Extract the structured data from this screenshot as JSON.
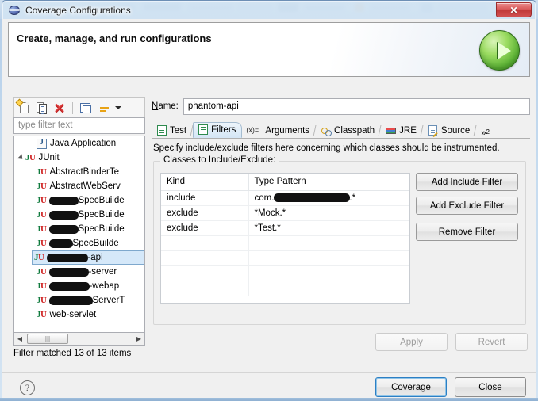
{
  "window": {
    "title": "Coverage Configurations",
    "title_icon": "eclipse-globe-icon",
    "close_label": "✕"
  },
  "banner": {
    "title": "Create, manage, and run configurations",
    "run_icon": "run-coverage-icon"
  },
  "toolbar": {
    "icons": [
      {
        "name": "new-configuration-icon",
        "title": "New launch configuration"
      },
      {
        "name": "duplicate-configuration-icon",
        "title": "Duplicate"
      },
      {
        "name": "delete-configuration-icon",
        "title": "Delete"
      },
      {
        "name": "collapse-all-icon",
        "title": "Collapse All"
      },
      {
        "name": "filter-launch-icon",
        "title": "Filter"
      },
      {
        "name": "chevron-down-icon",
        "title": "Menu"
      }
    ]
  },
  "filter": {
    "placeholder": "type filter text",
    "value": "",
    "status": "Filter matched 13 of 13 items"
  },
  "tree": {
    "items": [
      {
        "label": "Java Application",
        "icon": "java-application-icon",
        "indent": 1,
        "twisty": false,
        "selected": false,
        "redact": 0
      },
      {
        "label": "JUnit",
        "icon": "junit-icon",
        "indent": 0,
        "twisty": true,
        "selected": false,
        "redact": 0
      },
      {
        "label": "AbstractBinderTe",
        "icon": "junit-icon",
        "indent": 2,
        "twisty": false,
        "selected": false,
        "redact": 0
      },
      {
        "label": "AbstractWebServ",
        "icon": "junit-icon",
        "indent": 2,
        "twisty": false,
        "selected": false,
        "redact": 0
      },
      {
        "label": "SpecBuilde",
        "icon": "junit-icon",
        "indent": 2,
        "twisty": false,
        "selected": false,
        "redact": 37
      },
      {
        "label": "SpecBuilde",
        "icon": "junit-icon",
        "indent": 2,
        "twisty": false,
        "selected": false,
        "redact": 37
      },
      {
        "label": "SpecBuilde",
        "icon": "junit-icon",
        "indent": 2,
        "twisty": false,
        "selected": false,
        "redact": 37
      },
      {
        "label": "SpecBuilde",
        "icon": "junit-icon",
        "indent": 2,
        "twisty": false,
        "selected": false,
        "redact": 30
      },
      {
        "label": "-api",
        "icon": "junit-icon",
        "indent": 2,
        "twisty": false,
        "selected": true,
        "redact": 52
      },
      {
        "label": "-server",
        "icon": "junit-icon",
        "indent": 2,
        "twisty": false,
        "selected": false,
        "redact": 50
      },
      {
        "label": "-webap",
        "icon": "junit-icon",
        "indent": 2,
        "twisty": false,
        "selected": false,
        "redact": 51
      },
      {
        "label": "ServerT",
        "icon": "junit-icon",
        "indent": 2,
        "twisty": false,
        "selected": false,
        "redact": 55
      },
      {
        "label": "web-servlet",
        "icon": "junit-icon",
        "indent": 2,
        "twisty": false,
        "selected": false,
        "redact": 0
      }
    ]
  },
  "config": {
    "name_label": "Name:",
    "name_mnemonic": "N",
    "name_value": "phantom-api",
    "tabs": [
      {
        "label": "Test",
        "icon": "test-tab-icon",
        "active": false
      },
      {
        "label": "Filters",
        "icon": "filters-tab-icon",
        "active": true
      },
      {
        "label": "Arguments",
        "icon": "arguments-tab-icon",
        "active": false
      },
      {
        "label": "Classpath",
        "icon": "classpath-tab-icon",
        "active": false
      },
      {
        "label": "JRE",
        "icon": "jre-tab-icon",
        "active": false
      },
      {
        "label": "Source",
        "icon": "source-tab-icon",
        "active": false
      }
    ],
    "tabs_overflow": "»",
    "tabs_overflow_count": "2",
    "description": "Specify include/exclude filters here concerning which classes should be instrumented.",
    "group_title": "Classes to Include/Exclude:",
    "table": {
      "columns": [
        "Kind",
        "Type Pattern",
        ""
      ],
      "rows": [
        {
          "kind": "include",
          "pattern_prefix": "com.",
          "pattern_redact": 96,
          "pattern_suffix": ".*"
        },
        {
          "kind": "exclude",
          "pattern_prefix": "*Mock.*",
          "pattern_redact": 0,
          "pattern_suffix": ""
        },
        {
          "kind": "exclude",
          "pattern_prefix": "*Test.*",
          "pattern_redact": 0,
          "pattern_suffix": ""
        }
      ],
      "empty_rows": 4
    },
    "side_buttons": [
      {
        "label": "Add Include Filter",
        "name": "add-include-filter-button",
        "gap": false
      },
      {
        "label": "Add Exclude Filter",
        "name": "add-exclude-filter-button",
        "gap": false
      },
      {
        "label": "Remove Filter",
        "name": "remove-filter-button",
        "gap": true
      }
    ],
    "apply_label": "Apply",
    "apply_mnemonic": "l",
    "revert_label": "Revert",
    "revert_mnemonic": "v",
    "apply_enabled": false,
    "revert_enabled": false
  },
  "footer": {
    "help_icon": "help-icon",
    "help_glyph": "?",
    "primary_label": "Coverage",
    "secondary_label": "Close"
  },
  "colors": {
    "accent": "#2c7fc4",
    "selection": "#d5e8f9",
    "junit_green": "#0f7a3d",
    "junit_red": "#cf2020",
    "run_green": "#59b033",
    "close_red": "#c03838"
  }
}
